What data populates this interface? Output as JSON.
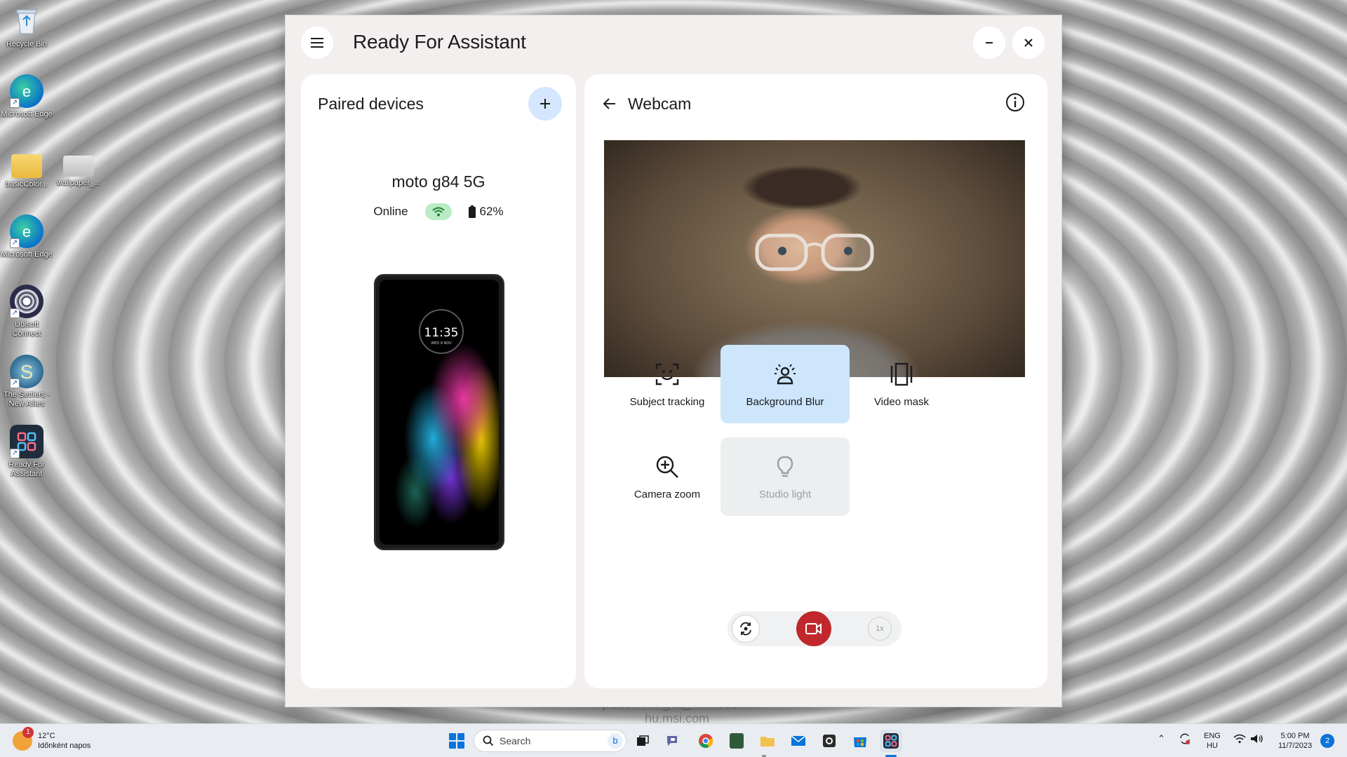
{
  "desktop": {
    "icons": [
      {
        "label": "Recycle Bin",
        "icon": "recycle-bin-icon"
      },
      {
        "label": "Microsoft Edge",
        "icon": "edge-icon"
      },
      {
        "label": "basicColor...",
        "icon": "folder-icon"
      },
      {
        "label": "wallpaper_...",
        "icon": "image-file-icon"
      },
      {
        "label": "Microsoft Edge",
        "icon": "edge-icon"
      },
      {
        "label": "Ubisoft Connect",
        "icon": "ubisoft-icon"
      },
      {
        "label": "The Settlers - New Allies",
        "icon": "settlers-icon"
      },
      {
        "label": "Ready For Assistant",
        "icon": "ready-for-icon"
      }
    ],
    "watermark": {
      "line1": "peter.varga@msi.com",
      "line2": "hu.msi.com"
    }
  },
  "app": {
    "title": "Ready For Assistant",
    "menu_icon": "hamburger-menu-icon",
    "minimize_icon": "minimize-icon",
    "close_icon": "close-icon"
  },
  "paired": {
    "title": "Paired devices",
    "add_icon": "plus-icon",
    "device_name": "moto g84 5G",
    "status": "Online",
    "battery": "62%",
    "phone_time": "11:35",
    "phone_date": "WED 8 NOV"
  },
  "webcam": {
    "title": "Webcam",
    "features": [
      {
        "label": "Subject tracking",
        "icon": "subject-tracking-icon",
        "state": "default"
      },
      {
        "label": "Background Blur",
        "icon": "background-blur-icon",
        "state": "active"
      },
      {
        "label": "Video mask",
        "icon": "video-mask-icon",
        "state": "default"
      },
      {
        "label": "Camera zoom",
        "icon": "zoom-in-icon",
        "state": "default"
      },
      {
        "label": "Studio light",
        "icon": "light-bulb-icon",
        "state": "disabled"
      }
    ],
    "zoom_level": "1x",
    "record_color": "#c0282d",
    "active_color": "#cde6fb"
  },
  "taskbar": {
    "temperature": "12°C",
    "weather_text": "Időnként napos",
    "weather_badge": "1",
    "search_placeholder": "Search",
    "language": "ENG",
    "region": "HU",
    "time": "5:00 PM",
    "date": "11/7/2023",
    "notifications": "2"
  }
}
